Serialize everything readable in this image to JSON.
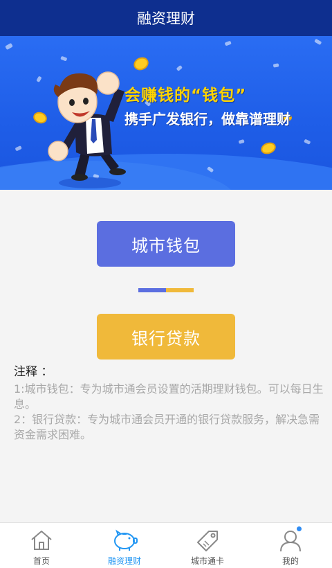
{
  "header": {
    "title": "融资理财"
  },
  "banner": {
    "headline": "会赚钱的“钱包”",
    "subline": "携手广发银行，做靠谱理财"
  },
  "actions": {
    "wallet_label": "城市钱包",
    "loan_label": "银行贷款"
  },
  "notes": {
    "title": "注释 ：",
    "items": [
      "1:城市钱包：专为城市通会员设置的活期理财钱包。可以每日生息。",
      "2：银行贷款：专为城市通会员开通的银行贷款服务，解决急需资金需求困难。"
    ]
  },
  "tabbar": {
    "items": [
      {
        "label": "首页",
        "icon": "home-icon",
        "active": false
      },
      {
        "label": "融资理财",
        "icon": "piggy-bank-icon",
        "active": true
      },
      {
        "label": "城市通卡",
        "icon": "price-tag-icon",
        "active": false
      },
      {
        "label": "我的",
        "icon": "user-icon",
        "active": false,
        "badge": true
      }
    ]
  },
  "colors": {
    "header": "#0e2f8f",
    "wallet_button": "#5b6ee0",
    "loan_button": "#f0b93a",
    "active_tab": "#2196f3"
  }
}
